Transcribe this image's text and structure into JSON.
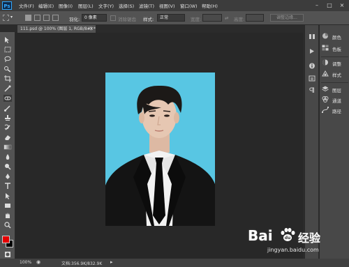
{
  "app": {
    "logo": "Ps"
  },
  "menu": [
    "文件(F)",
    "编辑(E)",
    "图像(I)",
    "图层(L)",
    "文字(Y)",
    "选择(S)",
    "滤镜(T)",
    "视图(V)",
    "窗口(W)",
    "帮助(H)"
  ],
  "options": {
    "feather_label": "羽化:",
    "feather_value": "0 像素",
    "antialias_label": "消除锯齿",
    "style_label": "样式:",
    "style_value": "正常",
    "width_label": "宽度:",
    "height_label": "高度:",
    "refine_edge": "调整边缘..."
  },
  "document": {
    "tab_title": "111.psd @ 100% (图层 1, RGB/8#) *",
    "close": "×"
  },
  "status": {
    "zoom": "100%",
    "doc_info": "文档:356.9K/832.9K"
  },
  "panels": {
    "col2": [
      "颜色",
      "色板",
      "调整",
      "样式",
      "图层",
      "通道",
      "路径"
    ]
  },
  "colors": {
    "foreground": "#e60000",
    "background": "#000000",
    "canvas_bg": "#58c6e3"
  },
  "watermark": {
    "brand": "Bai",
    "brand_cn": "经验",
    "url": "jingyan.baidu.com"
  }
}
